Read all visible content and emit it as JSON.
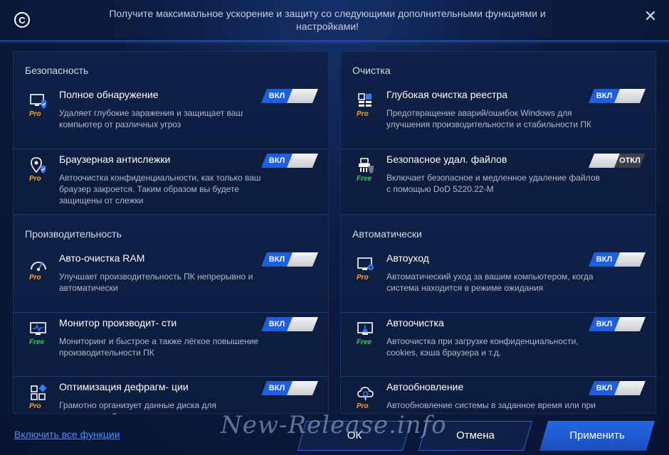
{
  "window": {
    "title": "Получите максимальное ускорение и защиту со следующими дополнительными функциями и настройками!",
    "close_glyph": "✕"
  },
  "colors": {
    "accent": "#1d5fe0",
    "pro": "#f1a22a",
    "free": "#37c45c",
    "link": "#4d8ff2"
  },
  "panels": [
    {
      "title": "Безопасность",
      "features": [
        {
          "name": "Полное обнаружение",
          "desc": "Удаляет глубокие заражения и защищает ваш компьютер от различных угроз",
          "tier": "Pro",
          "toggle": "ВКЛ",
          "state": "on",
          "icon": "monitor-shield-icon"
        },
        {
          "name": "Браузерная антислежки",
          "desc": "Автоочистка конфиденциальности, как только ваш браузер закроется. Таким образом вы будете защищены от слежки",
          "tier": "Pro",
          "toggle": "ВКЛ",
          "state": "on",
          "icon": "location-shield-icon"
        }
      ]
    },
    {
      "title": "Очистка",
      "features": [
        {
          "name": "Глубокая очистка реестра",
          "desc": "Предотвращение аварий/ошибок  Windows  для улучшения производительности и стабильности ПК",
          "tier": "Pro",
          "toggle": "ВКЛ",
          "state": "on",
          "icon": "registry-icon"
        },
        {
          "name": "Безопасное удал. файлов",
          "desc": "Включает безопасное и медленное удаление файлов с помощью DoD 5220.22-M",
          "tier": "Free",
          "toggle": "ОТКЛ",
          "state": "off",
          "icon": "shredder-icon"
        }
      ]
    },
    {
      "title": "Производительность",
      "features": [
        {
          "name": "Авто-очистка RAM",
          "desc": "Улучшает производительность ПК непрерывно и автоматически",
          "tier": "Pro",
          "toggle": "ВКЛ",
          "state": "on",
          "icon": "speedometer-icon"
        },
        {
          "name": "Монитор производит- сти",
          "desc": "Мониторинг и быстрое а также лёгкое повышение производительности ПК",
          "tier": "Free",
          "toggle": "ВКЛ",
          "state": "on",
          "icon": "monitor-pulse-icon"
        },
        {
          "name": "Оптимизация дефрагм- ции",
          "desc": "Грамотно организует данные диска для максимальной",
          "tier": "Pro",
          "toggle": "ВКЛ",
          "state": "on",
          "icon": "defrag-blocks-icon"
        }
      ]
    },
    {
      "title": "Автоматически",
      "features": [
        {
          "name": "Автоуход",
          "desc": "Автоматический уход за вашим компьютером, когда система находится в режиме ожидания",
          "tier": "Pro",
          "toggle": "ВКЛ",
          "state": "on",
          "icon": "monitor-gear-icon"
        },
        {
          "name": "Автоочистка",
          "desc": "Автоочистка при загрузке конфиденциальности, cookies, кэша браузера и т.д.",
          "tier": "Free",
          "toggle": "ВКЛ",
          "state": "on",
          "icon": "monitor-broom-icon"
        },
        {
          "name": "Автообновление",
          "desc": "Автообновление системы в заданное время или при",
          "tier": "Pro",
          "toggle": "ВКЛ",
          "state": "on",
          "icon": "cloud-refresh-icon"
        }
      ]
    }
  ],
  "footer": {
    "enable_all": "Включить все функции",
    "ok": "ОК",
    "cancel": "Отмена",
    "apply": "Применить"
  },
  "watermark": "New-Release.info"
}
